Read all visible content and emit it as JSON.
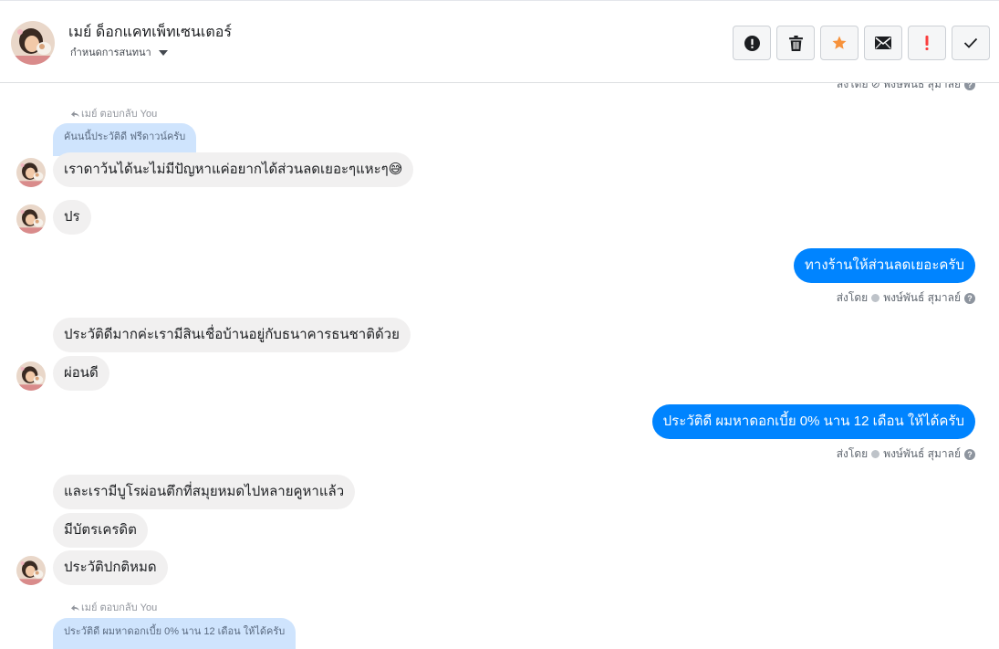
{
  "header": {
    "name": "เมย์ ด็อกแคทเพ็ทเซนเตอร์",
    "assign_label": "กำหนดการสนทนา",
    "actions": [
      "alert-circle-icon",
      "trash-icon",
      "star-icon",
      "envelope-icon",
      "exclamation-icon",
      "check-icon"
    ],
    "star_color": "#f7923b",
    "exclaim_color": "#fa3e3e"
  },
  "colors": {
    "outgoing_bubble": "#0084ff",
    "incoming_bubble": "#f1f0f0",
    "quote_bubble": "#cfe4fd"
  },
  "chat": {
    "top_partial_sent_by": "ส่งโดย ⊘ พงษ์พันธ์ สุมาลย์",
    "reply1": {
      "label": "เมย์ ตอบกลับ You",
      "quote": "คันนนี้ประวัติดี ฟรีดาวน์ครับ"
    },
    "msg1": "เราดาว้นได้นะไม่มีปัญหาแค่อยากได้ส่วนลดเยอะๆแหะๆ😅",
    "msg2": "ปร",
    "out1": {
      "text": "ทางร้านให้ส่วนลดเยอะครับ",
      "sent_by_prefix": "ส่งโดย",
      "sender": "พงษ์พันธ์ สุมาลย์"
    },
    "msg3": "ประวัติดีมากค่ะเรามีสินเชื่อบ้านอยู่กับธนาคารธนชาติด้วย",
    "msg4": "ผ่อนดี",
    "out2": {
      "text": "ประวัติดี ผมหาดอกเบี้ย 0% นาน 12 เดือน ให้ได้ครับ",
      "sent_by_prefix": "ส่งโดย",
      "sender": "พงษ์พันธ์ สุมาลย์"
    },
    "msg5": "และเรามีบูโรผ่อนตึกที่สมุยหมดไปหลายคูหาแล้ว",
    "msg6": "มีบัตรเครดิต",
    "msg7": "ประวัติปกติหมด",
    "reply2": {
      "label": "เมย์ ตอบกลับ You",
      "quote": "ประวัติดี ผมหาดอกเบี้ย 0% นาน 12 เดือน ให้ได้ครับ"
    }
  }
}
